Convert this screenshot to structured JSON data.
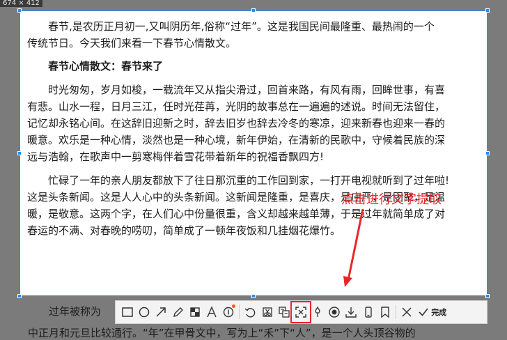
{
  "size_label": "674 × 412",
  "background_text": [
    "过年被称为",
    "中正月和元旦比较通行。“年”在甲骨文中，写为上“禾”下“人”，是一个人头顶谷物的"
  ],
  "document": {
    "paragraph1": [
      "春节,是农历正月初一,又叫阴历年,俗称“过年”。这是我国民间最隆重、最热闹的一个",
      "传统节日。今天我们来看一下春节心情散文。"
    ],
    "heading": "春节心情散文：春节来了",
    "paragraph2": [
      "时光匆匆，岁月如梭，一载流年又从指尖滑过，回首来路，有风有雨，回眸世事，有喜",
      "有悲。山水一程，日月三江，任时光荏苒，光阴的故事总在一遍遍的述说。时间无法留住，",
      "记忆却永铭心间。在这辞旧迎新之时，辞去旧岁也辞去冷冬的寒凉，迎来新春也迎来一春的",
      "暖意。欢乐是一种心情，淡然也是一种心境，新年伊始，在清新的民歌中，守候着民族的深",
      "远与浩翰，在歌声中一剪寒梅伴着雪花带着新年的祝福香飘四方!"
    ],
    "paragraph3": [
      "忙碌了一年的亲人朋友都放下了往日那沉重的工作回到家，一打开电视就听到了过年啦!",
      "这是头条新闻。这是人人心中的头条新闻。这新闻是隆重，是喜庆，是庄严，是团聚，是温",
      "暖，是敬意。这两个字，在人们心中份量很重，含义却越来越单薄，于是过年就简单成了对",
      "春运的不满、对春晚的唠叨，简单成了一顿年夜饭和几挂烟花爆竹。"
    ]
  },
  "annotation": "点击进行文字提取",
  "toolbar": {
    "finish_label": "完成"
  },
  "colors": {
    "selection_border": "#1e8fff",
    "annotation": "#e8262a",
    "badge": "#f25a1c"
  }
}
